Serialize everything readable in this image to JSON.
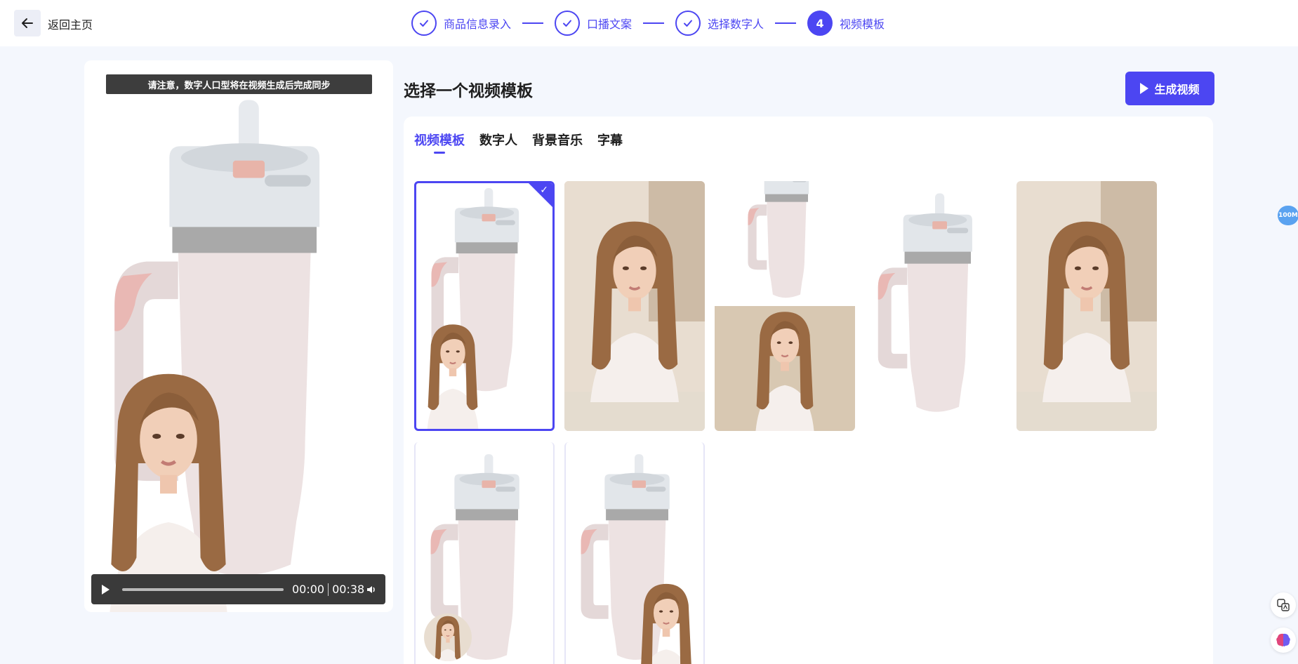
{
  "header": {
    "back_label": "返回主页",
    "steps": [
      {
        "label": "商品信息录入",
        "state": "done"
      },
      {
        "label": "口播文案",
        "state": "done"
      },
      {
        "label": "选择数字人",
        "state": "done"
      },
      {
        "label": "视频模板",
        "state": "active",
        "number": "4"
      }
    ]
  },
  "preview": {
    "notice": "请注意，数字人口型将在视频生成后完成同步",
    "player": {
      "current_time": "00:00",
      "duration": "00:38"
    }
  },
  "main": {
    "title": "选择一个视频模板",
    "generate_button": "生成视频",
    "tabs": [
      {
        "label": "视频模板",
        "active": true
      },
      {
        "label": "数字人",
        "active": false
      },
      {
        "label": "背景音乐",
        "active": false
      },
      {
        "label": "字幕",
        "active": false
      }
    ],
    "templates": [
      {
        "layout": "product-with-corner-presenter",
        "selected": true
      },
      {
        "layout": "presenter-full",
        "selected": false
      },
      {
        "layout": "split-product-presenter",
        "selected": false
      },
      {
        "layout": "product-only",
        "selected": false
      },
      {
        "layout": "presenter-full",
        "selected": false
      },
      {
        "layout": "product-with-round-avatar",
        "selected": false
      },
      {
        "layout": "product-with-bottom-presenter",
        "selected": false
      }
    ]
  },
  "side": {
    "memory_badge": "100M"
  },
  "colors": {
    "accent": "#4c46f2",
    "background": "#f4f7fd",
    "cup_body": "#e9dada",
    "lid": "#dfe3e8",
    "hair": "#9a6a43",
    "shirt": "#f5efec"
  }
}
